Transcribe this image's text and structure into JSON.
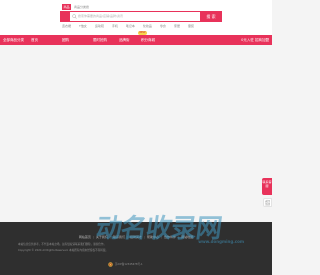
{
  "header": {
    "search_tab_active": "商品",
    "search_tab_2": "商品分类搜",
    "search_category": "",
    "search_placeholder": "搜索你需要的商品/店铺/品牌/资讯",
    "search_button": "搜 索",
    "hot_words": [
      "连衣裙",
      "T恤女",
      "运动鞋",
      "手机",
      "笔记本",
      "化妆品",
      "零食",
      "家居",
      "童装"
    ]
  },
  "nav": {
    "items": [
      "全部商品分类",
      "首页",
      "团购",
      "限时抢购",
      "品牌街",
      "积分商城"
    ],
    "new_badge": "NEW",
    "right_text": "0元入驻 招商加盟"
  },
  "float_tabs": {
    "tab1": "联系客服",
    "tab2": "返回顶部"
  },
  "footer": {
    "links": [
      "网站首页",
      "关于我们",
      "联系我们",
      "招聘英才",
      "帮助中心",
      "合作伙伴",
      "网站地图"
    ],
    "note_1": "本站信息仅供参考，不代表本站立场。如有侵权请联系我们删除，谢谢合作。",
    "note_2": "Copyright © 2024 All Rights Reserved. 本站所有内容未经授权不得转载。",
    "record_text": "苏ICP备12345678号-1"
  },
  "watermark": {
    "chars": [
      "动",
      "名",
      "收",
      "录",
      "网"
    ],
    "domain": "www.dongming.com"
  },
  "colors": {
    "accent": "#e8325a",
    "footer_bg": "#2f2f2f",
    "page_bg": "#f4f4f4"
  }
}
